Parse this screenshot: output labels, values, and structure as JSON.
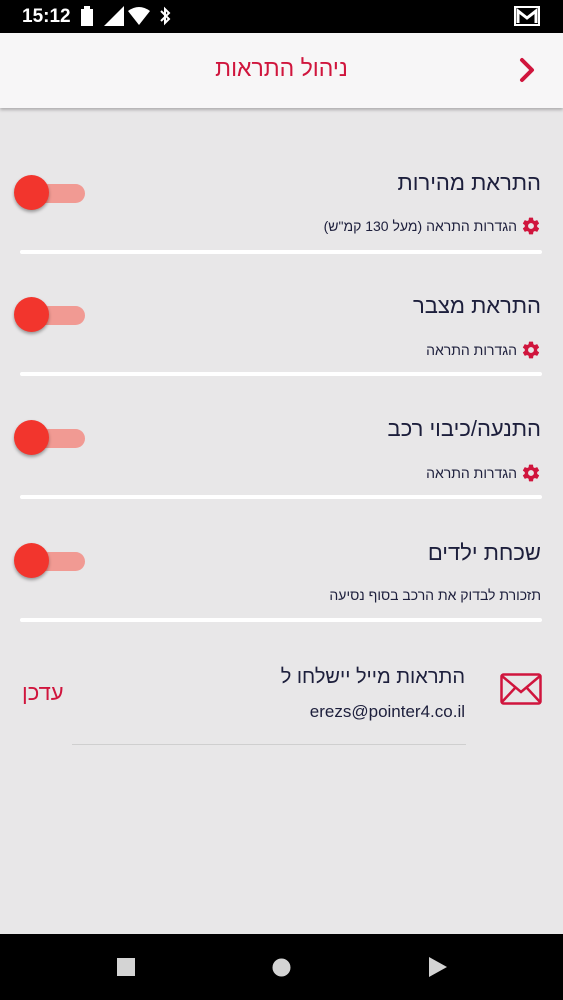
{
  "status_bar": {
    "time": "15:12"
  },
  "header": {
    "title": "ניהול התראות"
  },
  "sections": [
    {
      "title": "התראת מהירות",
      "subtitle": "הגדרות התראה (מעל 130 קמ\"ש)",
      "has_gear": true,
      "toggle_on": true
    },
    {
      "title": "התראת מצבר",
      "subtitle": "הגדרות התראה",
      "has_gear": true,
      "toggle_on": true
    },
    {
      "title": "התנעה/כיבוי רכב",
      "subtitle": "הגדרות התראה",
      "has_gear": true,
      "toggle_on": true
    },
    {
      "title": "שכחת ילדים",
      "subtitle": "תזכורת לבדוק את הרכב בסוף נסיעה",
      "has_gear": false,
      "toggle_on": true
    }
  ],
  "email": {
    "title": "התראות מייל יישלחו ל",
    "address": "erezs@pointer4.co.il",
    "update_label": "עדכן"
  },
  "colors": {
    "accent": "#d0153d",
    "toggle_thumb": "#f2352d",
    "toggle_track": "#f19a93",
    "text": "#1d1f3c"
  }
}
